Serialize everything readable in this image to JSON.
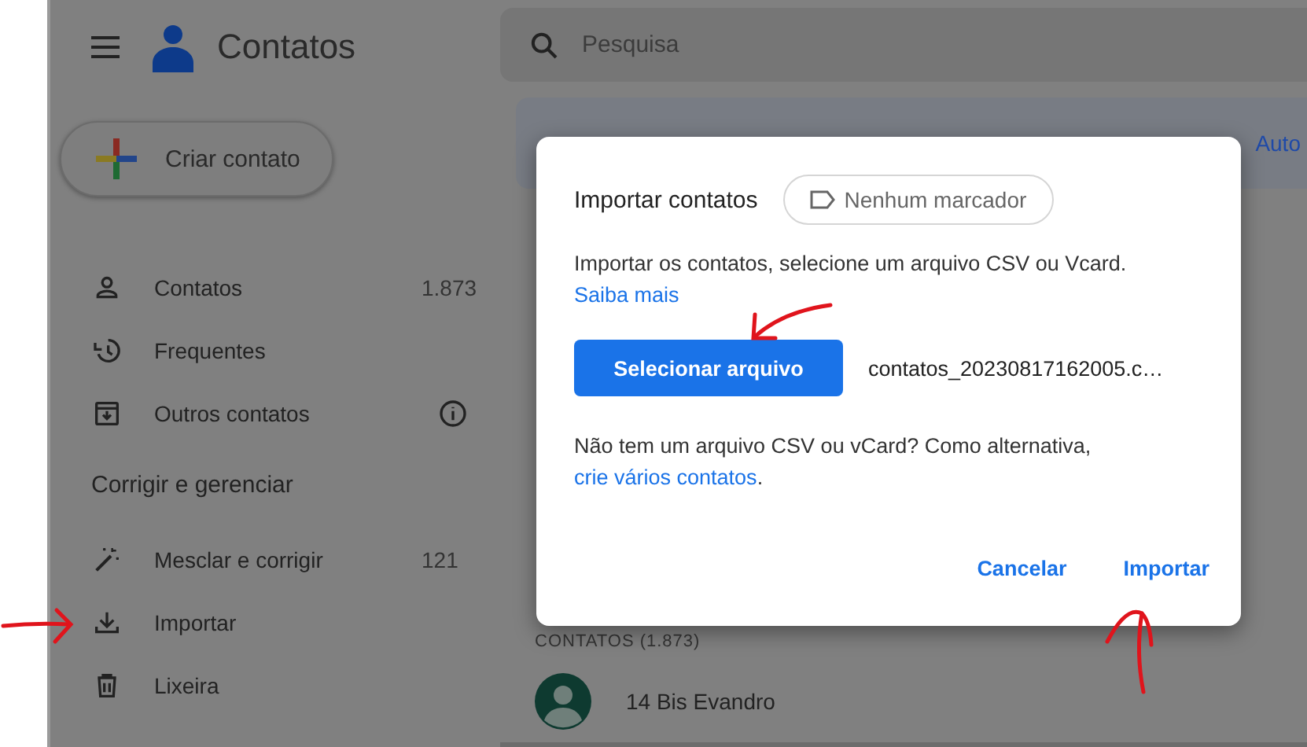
{
  "app": {
    "title": "Contatos"
  },
  "search": {
    "placeholder": "Pesquisa"
  },
  "create_button": "Criar contato",
  "sidebar": {
    "items": [
      {
        "label": "Contatos",
        "count": "1.873",
        "has_info": false
      },
      {
        "label": "Frequentes",
        "has_info": false
      },
      {
        "label": "Outros contatos",
        "has_info": true
      }
    ],
    "section_title": "Corrigir e gerenciar",
    "manage_items": [
      {
        "label": "Mesclar e corrigir",
        "count": "121"
      },
      {
        "label": "Importar"
      },
      {
        "label": "Lixeira"
      }
    ]
  },
  "banner": {
    "text": "Auto"
  },
  "contacts": {
    "header": "CONTATOS (1.873)",
    "rows": [
      {
        "name": "14 Bis Evandro"
      }
    ]
  },
  "dialog": {
    "title": "Importar contatos",
    "label_chip": "Nenhum marcador",
    "description": "Importar os contatos, selecione um arquivo CSV ou Vcard.",
    "learn_more": "Saiba mais",
    "select_button": "Selecionar arquivo",
    "file_name": "contatos_20230817162005.c…",
    "alt_text": "Não tem um arquivo CSV ou vCard? Como alternativa,",
    "alt_link": "crie vários contatos",
    "alt_end": ".",
    "actions": [
      "Cancelar",
      "Importar"
    ]
  }
}
